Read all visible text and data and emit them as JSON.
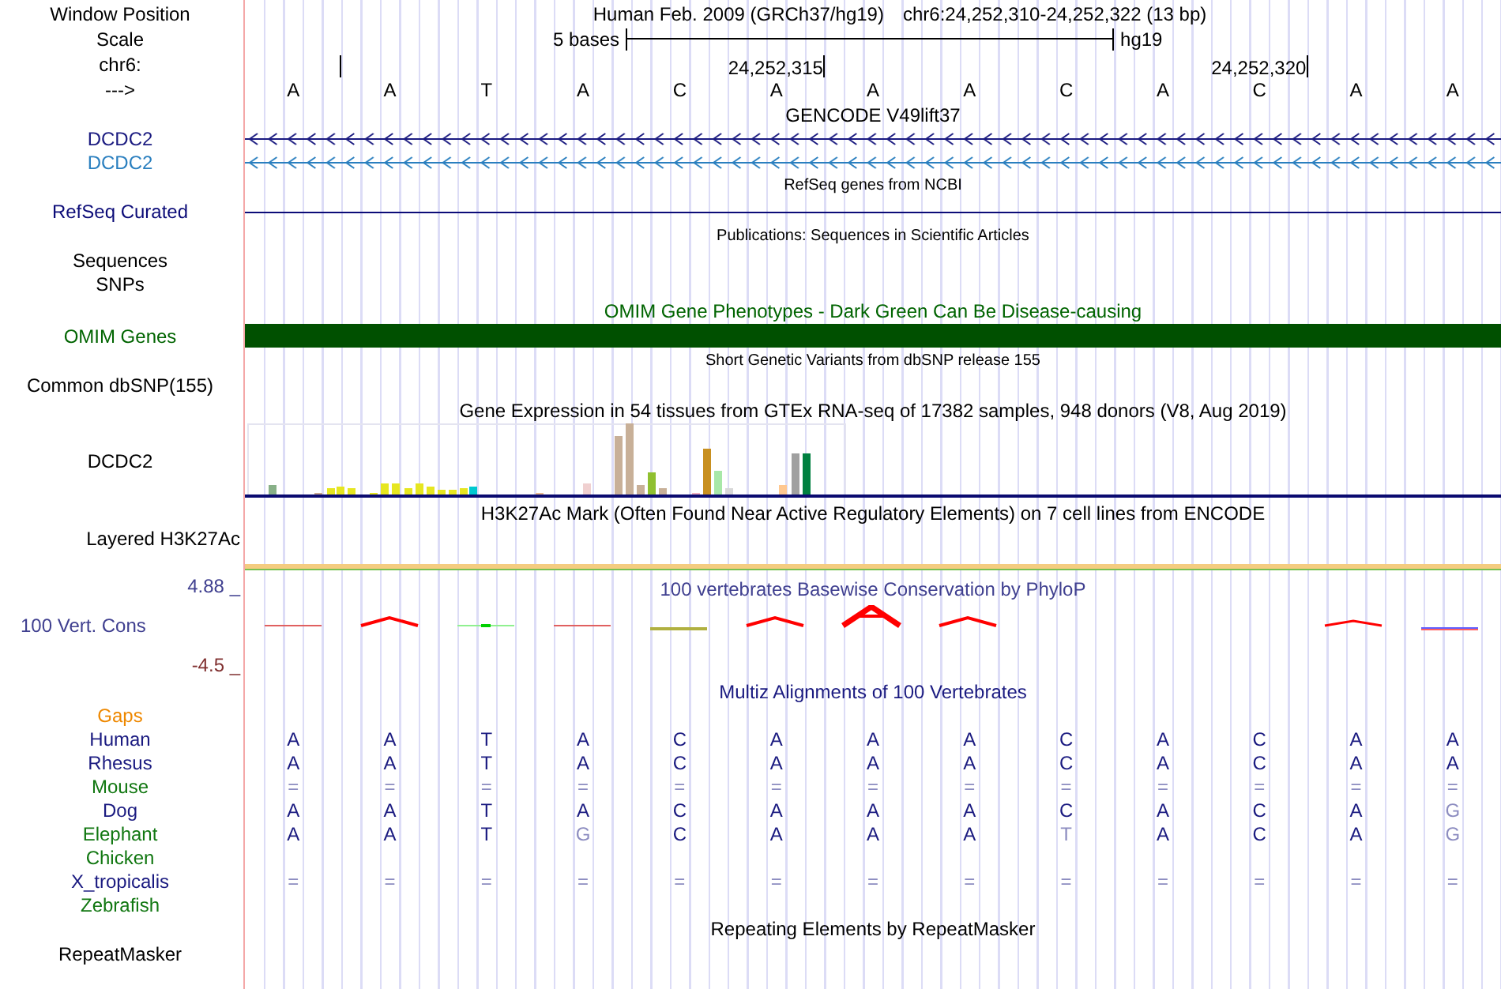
{
  "header": {
    "label": "Window Position",
    "assembly": "Human Feb. 2009 (GRCh37/hg19)",
    "position": "chr6:24,252,310-24,252,322 (13 bp)"
  },
  "scale": {
    "label": "Scale",
    "size": "5 bases",
    "assembly": "hg19"
  },
  "coordinates": {
    "label": "chr6:",
    "tick_labels": [
      "24,252,315",
      "24,252,320"
    ]
  },
  "strand": {
    "label": "--->",
    "bases": [
      "A",
      "A",
      "T",
      "A",
      "C",
      "A",
      "A",
      "A",
      "C",
      "A",
      "C",
      "A",
      "A"
    ]
  },
  "gencode": {
    "title": "GENCODE V49lift37",
    "genes": [
      {
        "name": "DCDC2"
      },
      {
        "name": "DCDC2"
      }
    ]
  },
  "refseq": {
    "title": "RefSeq genes from NCBI",
    "label": "RefSeq Curated"
  },
  "publications": {
    "title": "Publications: Sequences in Scientific Articles",
    "labels": [
      "Sequences",
      "SNPs"
    ]
  },
  "omim": {
    "title": "OMIM Gene Phenotypes - Dark Green Can Be Disease-causing",
    "label": "OMIM Genes"
  },
  "dbsnp": {
    "title": "Short Genetic Variants from dbSNP release 155",
    "label": "Common dbSNP(155)"
  },
  "gtex": {
    "title": "Gene Expression in 54 tissues from GTEx RNA-seq of 17382 samples, 948 donors (V8, Aug 2019)",
    "label": "DCDC2"
  },
  "h3k27ac": {
    "title": "H3K27Ac Mark (Often Found Near Active Regulatory Elements) on 7 cell lines from ENCODE",
    "label": "Layered H3K27Ac"
  },
  "conservation": {
    "title": "100 vertebrates Basewise Conservation by PhyloP",
    "label": "100 Vert. Cons",
    "max": "4.88 _",
    "min": "-4.5 _"
  },
  "multiz": {
    "title": "Multiz Alignments of 100 Vertebrates",
    "gaps_label": "Gaps",
    "species": [
      {
        "name": "Human",
        "color": "#1a1a80",
        "bases": [
          "A",
          "A",
          "T",
          "A",
          "C",
          "A",
          "A",
          "A",
          "C",
          "A",
          "C",
          "A",
          "A"
        ]
      },
      {
        "name": "Rhesus",
        "color": "#1a1a80",
        "bases": [
          "A",
          "A",
          "T",
          "A",
          "C",
          "A",
          "A",
          "A",
          "C",
          "A",
          "C",
          "A",
          "A"
        ]
      },
      {
        "name": "Mouse",
        "color": "#117711",
        "bases": [
          "=",
          "=",
          "=",
          "=",
          "=",
          "=",
          "=",
          "=",
          "=",
          "=",
          "=",
          "=",
          "="
        ]
      },
      {
        "name": "Dog",
        "color": "#1a1a80",
        "bases": [
          "A",
          "A",
          "T",
          "A",
          "C",
          "A",
          "A",
          "A",
          "C",
          "A",
          "C",
          "A",
          "G"
        ]
      },
      {
        "name": "Elephant",
        "color": "#117711",
        "bases": [
          "A",
          "A",
          "T",
          "G",
          "C",
          "A",
          "A",
          "A",
          "T",
          "A",
          "C",
          "A",
          "G"
        ]
      },
      {
        "name": "Chicken",
        "color": "#117711"
      },
      {
        "name": "X_tropicalis",
        "color": "#1a1a80",
        "bases": [
          "=",
          "=",
          "=",
          "=",
          "=",
          "=",
          "=",
          "=",
          "=",
          "=",
          "=",
          "=",
          "="
        ]
      },
      {
        "name": "Zebrafish",
        "color": "#117711"
      }
    ]
  },
  "repeatmasker": {
    "title": "Repeating Elements by RepeatMasker",
    "label": "RepeatMasker"
  }
}
